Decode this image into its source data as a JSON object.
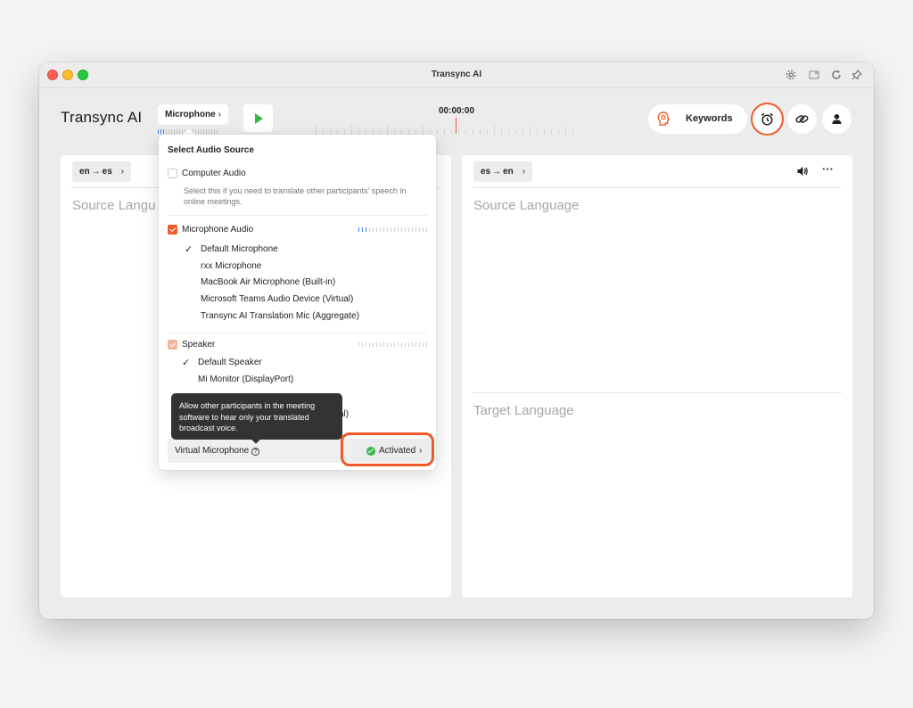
{
  "window": {
    "title": "Transync AI"
  },
  "header": {
    "brand": "Transync AI",
    "mic_source": "Microphone",
    "timer": "00:00:00",
    "keywords_label": "Keywords"
  },
  "left_panel": {
    "lang_from": "en",
    "lang_to": "es",
    "placeholder": "Source Langu"
  },
  "right_panel": {
    "lang_from": "es",
    "lang_to": "en",
    "source_placeholder": "Source Language",
    "target_placeholder": "Target Language"
  },
  "audio_dropdown": {
    "title": "Select Audio Source",
    "computer_audio": {
      "label": "Computer Audio",
      "checked": false,
      "description": "Select this if you need to translate other participants' speech in online meetings."
    },
    "microphone_audio": {
      "label": "Microphone Audio",
      "checked": true,
      "devices": [
        {
          "label": "Default Microphone",
          "selected": true
        },
        {
          "label": "rxx Microphone",
          "selected": false
        },
        {
          "label": "MacBook Air Microphone (Built-in)",
          "selected": false
        },
        {
          "label": "Microsoft Teams Audio Device (Virtual)",
          "selected": false
        },
        {
          "label": "Transync AI Translation Mic (Aggregate)",
          "selected": false
        }
      ]
    },
    "speaker": {
      "label": "Speaker",
      "checked": true,
      "devices": [
        {
          "label": "Default Speaker",
          "selected": true
        },
        {
          "label": "Mi Monitor (DisplayPort)",
          "selected": false
        }
      ],
      "obscured_item_suffix": "al)"
    },
    "virtual_mic": {
      "label": "Virtual Microphone",
      "status": "Activated",
      "tooltip": "Allow other participants in the meeting software to hear only your translated broadcast voice."
    }
  },
  "colors": {
    "accent": "#f05a28",
    "active": "#39b54a",
    "level": "#3a87e8"
  }
}
